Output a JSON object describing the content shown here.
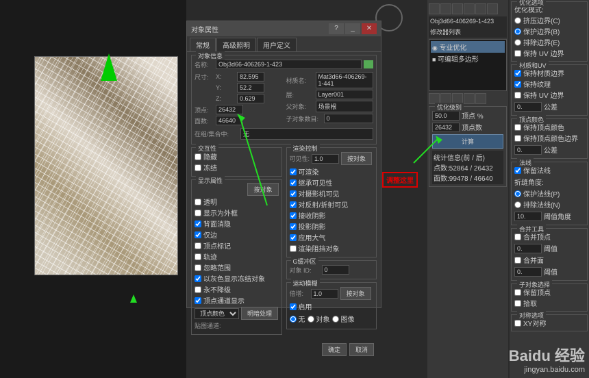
{
  "dialog": {
    "title": "对象属性",
    "tabs": [
      "常规",
      "高级照明",
      "用户定义"
    ],
    "object_info": {
      "legend": "对象信息",
      "name_label": "名称:",
      "name": "Obj3d66-406269-1-423",
      "size_label": "尺寸:",
      "x": "82.595",
      "y": "52.2",
      "z": "0.629",
      "verts_label": "顶点:",
      "verts": "26432",
      "faces_label": "面数:",
      "faces": "46640",
      "material_label": "材质名:",
      "material": "Mat3d66-406269-1-441",
      "layer_label": "层:",
      "layer": "Layer001",
      "parent_label": "父对象:",
      "parent": "场景根",
      "children_label": "子对象数目:",
      "children": "0",
      "group_label": "在组/集合中:",
      "group": "无"
    },
    "interactivity": {
      "legend": "交互性",
      "hide": "隐藏",
      "freeze": "冻结"
    },
    "display": {
      "legend": "显示属性",
      "by_object": "按对象",
      "transparent": "透明",
      "as_box": "显示为外框",
      "backface": "背面消隐",
      "edges_only": "仅边",
      "vert_ticks": "顶点标记",
      "trajectory": "轨迹",
      "ignore_extents": "忽略范围",
      "gray_frozen": "以灰色显示冻结对象",
      "never_degrade": "永不降级",
      "vert_channel": "顶点通道显示",
      "vert_color": "顶点颜色",
      "shading": "明暗处理",
      "map_channel": "贴图通道:"
    },
    "render": {
      "legend": "渲染控制",
      "visibility": "可见性:",
      "visibility_val": "1.0",
      "by_object": "按对象",
      "renderable": "可渲染",
      "inherit_vis": "继承可见性",
      "cam_visible": "对摄影机可见",
      "refl_visible": "对反射/折射可见",
      "receive_shadow": "接收阴影",
      "cast_shadow": "投影阴影",
      "apply_atmos": "应用大气",
      "render_occluded": "渲染阻挡对象"
    },
    "gbuffer": {
      "legend": "G缓冲区",
      "obj_id_label": "对象 ID:",
      "obj_id": "0"
    },
    "motion_blur": {
      "legend": "运动模糊",
      "multiplier_label": "倍增:",
      "multiplier": "1.0",
      "by_object": "按对象",
      "enable": "启用",
      "none": "无",
      "object": "对象",
      "image": "图像"
    },
    "ok": "确定",
    "cancel": "取消"
  },
  "annotation": "调整这里",
  "right1": {
    "obj_name": "Obj3d66-406269-1-423",
    "mod_label": "修改器列表",
    "mod1": "专业优化",
    "mod2": "可编辑多边形",
    "opt_level": {
      "legend": "优化级别",
      "vert_pct_val": "50.0",
      "vert_pct": "顶点 %",
      "vert_count_val": "26432",
      "vert_count": "顶点数",
      "calc": "计算",
      "stats_title": "统计信息(前 / 后)",
      "stats_verts": "点数:52864 / 26432",
      "stats_faces": "面数:99478 / 46640"
    }
  },
  "right2": {
    "opt_options": {
      "legend": "优化选项",
      "mode_label": "优化模式:",
      "crunch_border": "挤压边界(C)",
      "protect_border": "保护边界(B)",
      "exclude_border": "排除边界(E)",
      "keep_uv_border": "保持 UV 边界"
    },
    "mat_uv": {
      "legend": "材质和UV",
      "keep_mat_border": "保持材质边界",
      "keep_texture": "保持纹理",
      "keep_uv_border": "保持 UV 边界",
      "tolerance": "公差"
    },
    "vcolor": {
      "legend": "顶点颜色",
      "keep_vcolor": "保持顶点颜色",
      "keep_vcolor_border": "保持顶点颜色边界",
      "tolerance": "公差"
    },
    "normals": {
      "legend": "法线",
      "keep_normals": "保留法线",
      "crease_angle": "折缝角度:",
      "protect_normals": "保护法线(P)",
      "exclude_normals": "排除法线(N)",
      "threshold": "阈值角度"
    },
    "merge": {
      "legend": "合并工具",
      "merge_verts": "合并顶点",
      "merge_faces": "合并面",
      "threshold": "阈值"
    },
    "sub_select": {
      "legend": "子对象选择",
      "keep_verts": "保留顶点",
      "misc": "拾取"
    },
    "symmetry": {
      "legend": "对称选项",
      "xy": "XY对称"
    }
  },
  "watermark": {
    "logo": "Baidu 经验",
    "url": "jingyan.baidu.com"
  }
}
